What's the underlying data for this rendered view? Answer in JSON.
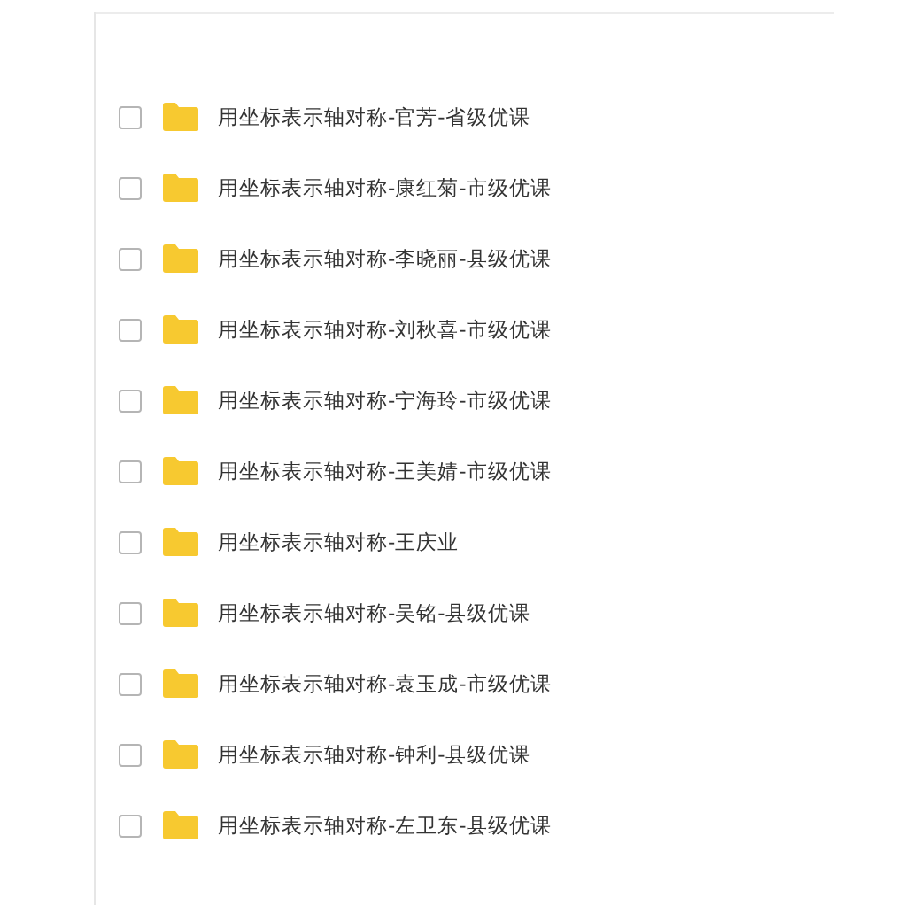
{
  "files": [
    {
      "name": "用坐标表示轴对称-官芳-省级优课",
      "checked": false
    },
    {
      "name": "用坐标表示轴对称-康红菊-市级优课",
      "checked": false
    },
    {
      "name": "用坐标表示轴对称-李晓丽-县级优课",
      "checked": false
    },
    {
      "name": "用坐标表示轴对称-刘秋喜-市级优课",
      "checked": false
    },
    {
      "name": "用坐标表示轴对称-宁海玲-市级优课",
      "checked": false
    },
    {
      "name": "用坐标表示轴对称-王美婧-市级优课",
      "checked": false
    },
    {
      "name": "用坐标表示轴对称-王庆业",
      "checked": false
    },
    {
      "name": "用坐标表示轴对称-吴铭-县级优课",
      "checked": false
    },
    {
      "name": "用坐标表示轴对称-袁玉成-市级优课",
      "checked": false
    },
    {
      "name": "用坐标表示轴对称-钟利-县级优课",
      "checked": false
    },
    {
      "name": "用坐标表示轴对称-左卫东-县级优课",
      "checked": false
    }
  ]
}
